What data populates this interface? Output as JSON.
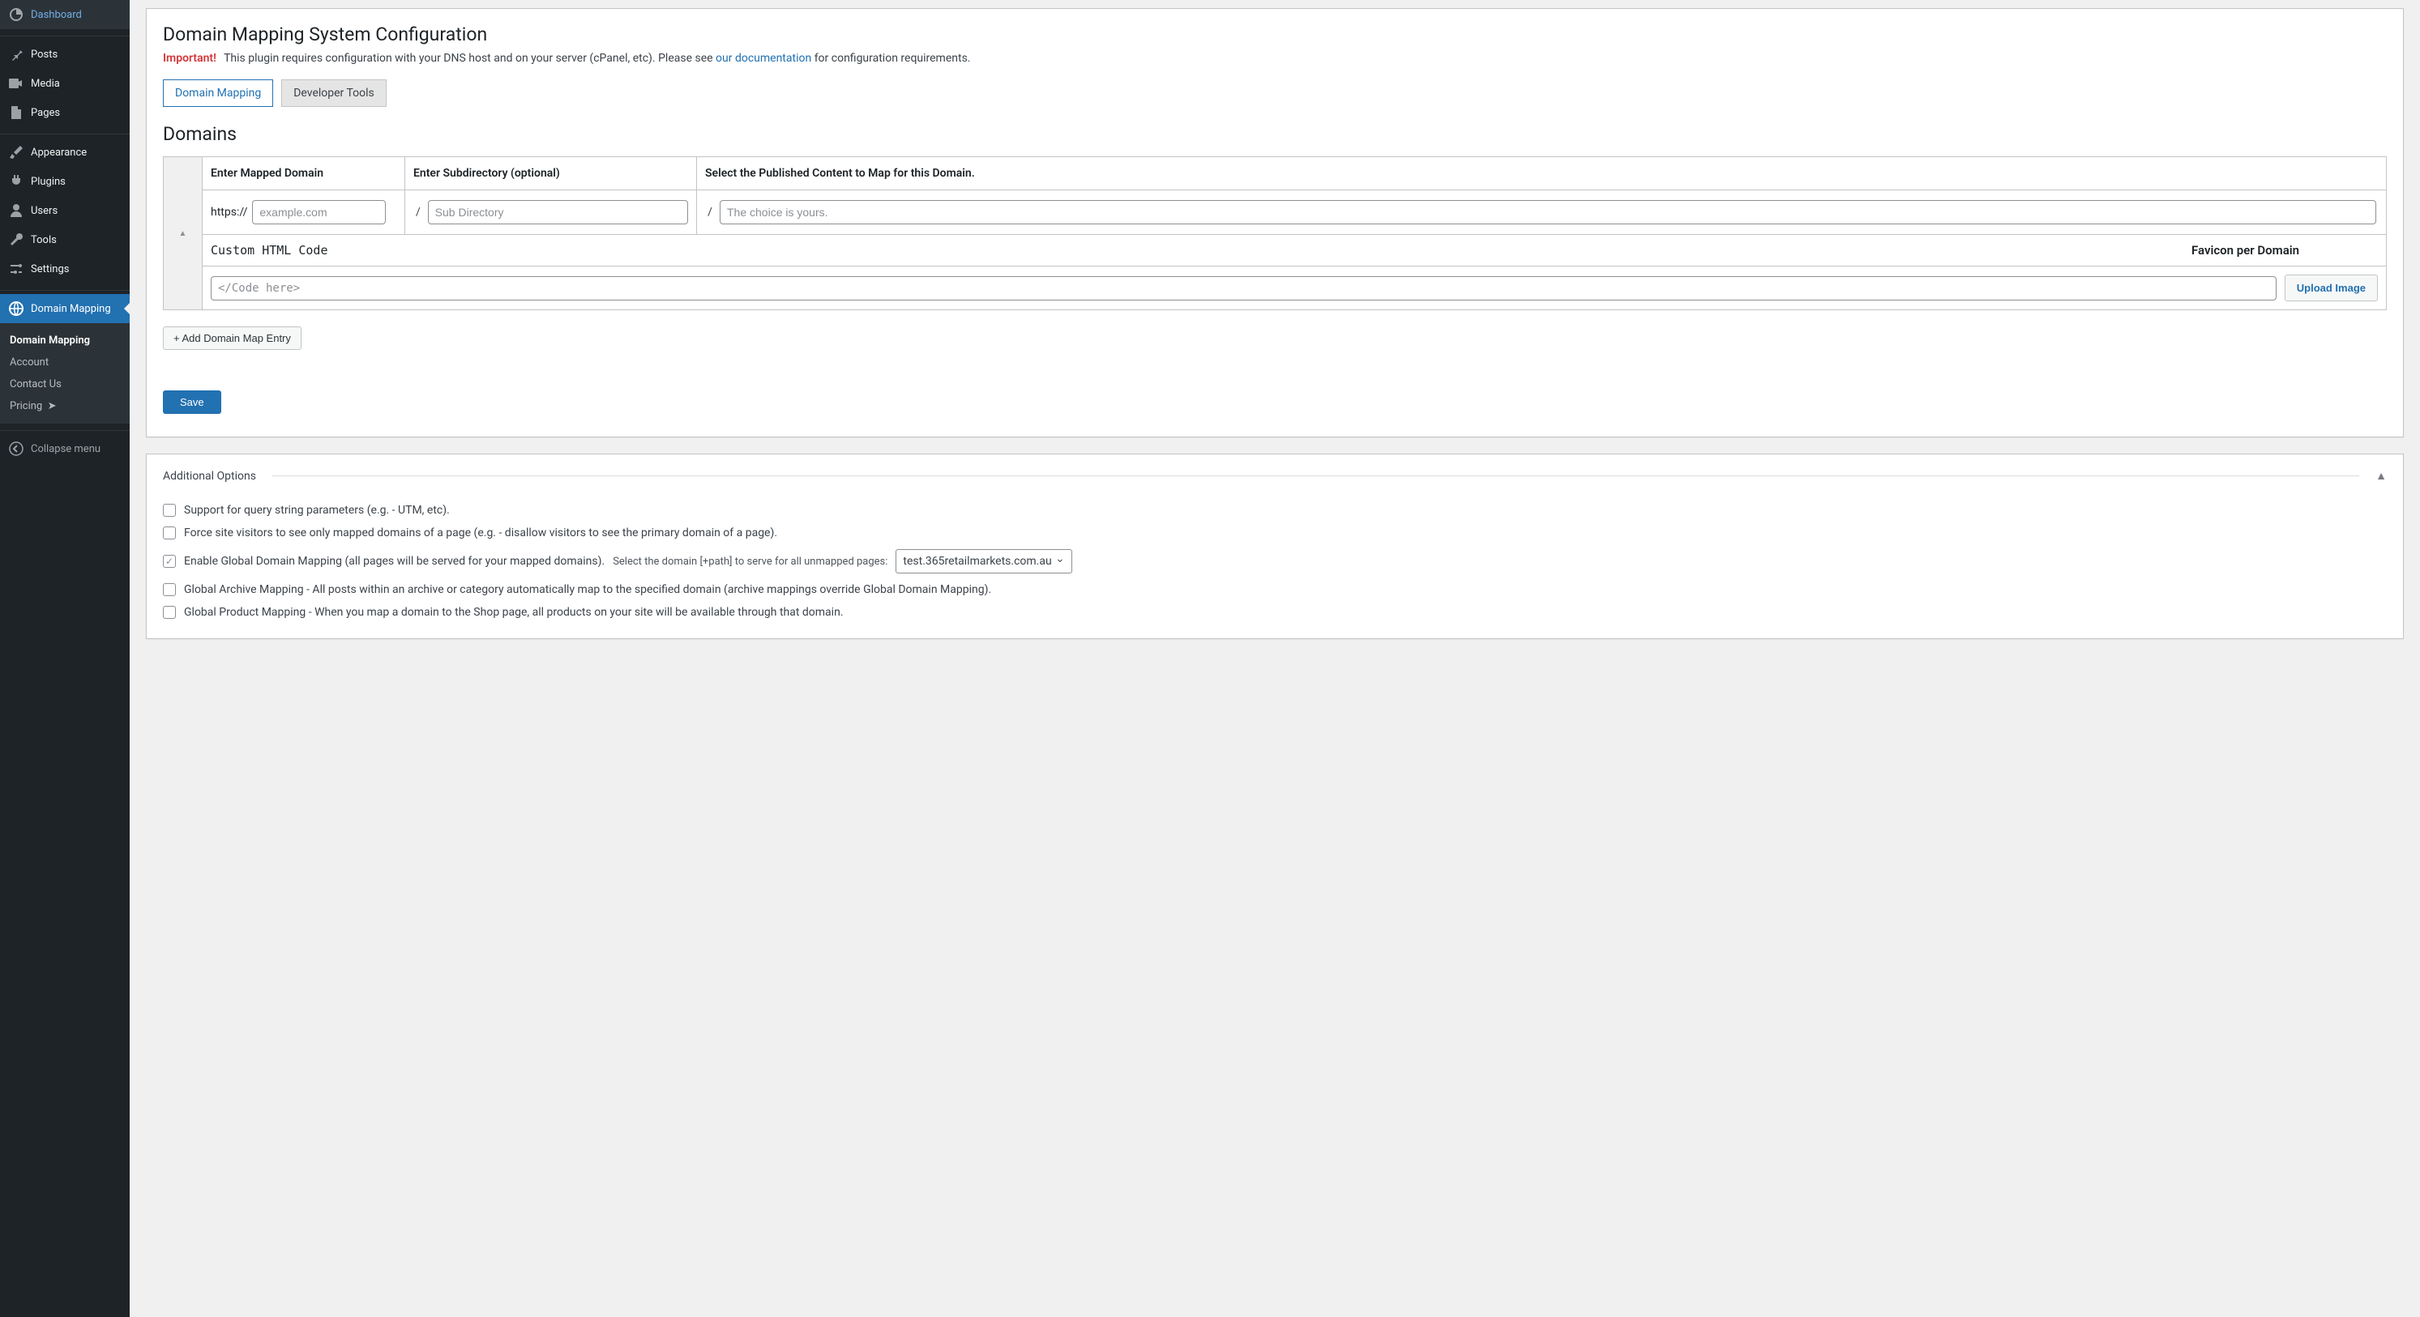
{
  "sidebar": {
    "items": [
      {
        "label": "Dashboard",
        "icon": "dashboard"
      },
      {
        "label": "Posts",
        "icon": "pushpin"
      },
      {
        "label": "Media",
        "icon": "media"
      },
      {
        "label": "Pages",
        "icon": "page"
      },
      {
        "label": "Appearance",
        "icon": "brush"
      },
      {
        "label": "Plugins",
        "icon": "plug"
      },
      {
        "label": "Users",
        "icon": "user"
      },
      {
        "label": "Tools",
        "icon": "wrench"
      },
      {
        "label": "Settings",
        "icon": "sliders"
      },
      {
        "label": "Domain Mapping",
        "icon": "globe"
      }
    ],
    "submenu": [
      {
        "label": "Domain Mapping"
      },
      {
        "label": "Account"
      },
      {
        "label": "Contact Us"
      },
      {
        "label": "Pricing"
      }
    ],
    "collapse": "Collapse menu"
  },
  "page": {
    "title": "Domain Mapping System Configuration",
    "important": "Important!",
    "notice_1": "This plugin requires configuration with your DNS host and on your server (cPanel, etc). Please see ",
    "notice_link": "our documentation",
    "notice_2": " for configuration requirements.",
    "tabs": {
      "mapping": "Domain Mapping",
      "dev": "Developer Tools"
    },
    "section_domains": "Domains",
    "th_domain": "Enter Mapped Domain",
    "th_subdir": "Enter Subdirectory (optional)",
    "th_content": "Select the Published Content to Map for this Domain.",
    "https_prefix": "https://",
    "ph_domain": "example.com",
    "ph_subdir": "Sub Directory",
    "ph_content": "The choice is yours.",
    "th_html": "Custom HTML Code",
    "th_favicon": "Favicon per Domain",
    "ph_code": "</Code here>",
    "btn_upload": "Upload Image",
    "btn_add": "+ Add Domain Map Entry",
    "btn_save": "Save",
    "section_options": "Additional Options",
    "opt1": "Support for query string parameters (e.g. - UTM, etc).",
    "opt2": "Force site visitors to see only mapped domains of a page (e.g. - disallow visitors to see the primary domain of a page).",
    "opt3": "Enable Global Domain Mapping (all pages will be served for your mapped domains).",
    "opt3_sub": "Select the domain [+path] to serve for all unmapped pages:",
    "opt3_sel": "test.365retailmarkets.com.au",
    "opt4": "Global Archive Mapping - All posts within an archive or category automatically map to the specified domain (archive mappings override Global Domain Mapping).",
    "opt5": "Global Product Mapping - When you map a domain to the Shop page, all products on your site will be available through that domain."
  }
}
